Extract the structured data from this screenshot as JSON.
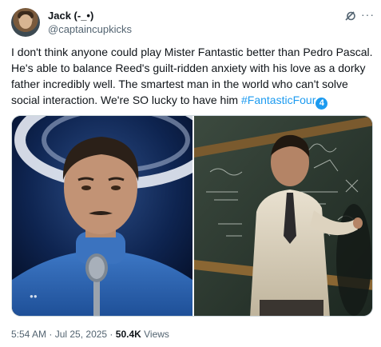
{
  "author": {
    "display_name": "Jack (-_•)",
    "handle": "@captaincupkicks",
    "avatar_icon": "avatar-photo"
  },
  "header_icons": [
    "grok-icon",
    "more-icon"
  ],
  "tweet": {
    "text": "I don't think anyone could play Mister Fantastic better than Pedro Pascal. He's able to balance Reed's guilt-ridden anxiety with his love as a dorky father incredibly well. The smartest man in the world who can't solve social interaction. We're SO lucky to have him ",
    "hashtag": "#FantasticFour",
    "hashtag_emoji": "4"
  },
  "media": {
    "left_caption": "●●",
    "images": [
      "man-at-microphone-photo",
      "man-at-chalkboard-photo"
    ]
  },
  "footer": {
    "time": "5:54 AM",
    "sep1": " · ",
    "date": "Jul 25, 2025",
    "sep2": " · ",
    "views_count": "50.4K",
    "views_label": " Views"
  },
  "colors": {
    "link": "#1d9bf0",
    "secondary": "#536471",
    "text": "#0f1419"
  }
}
